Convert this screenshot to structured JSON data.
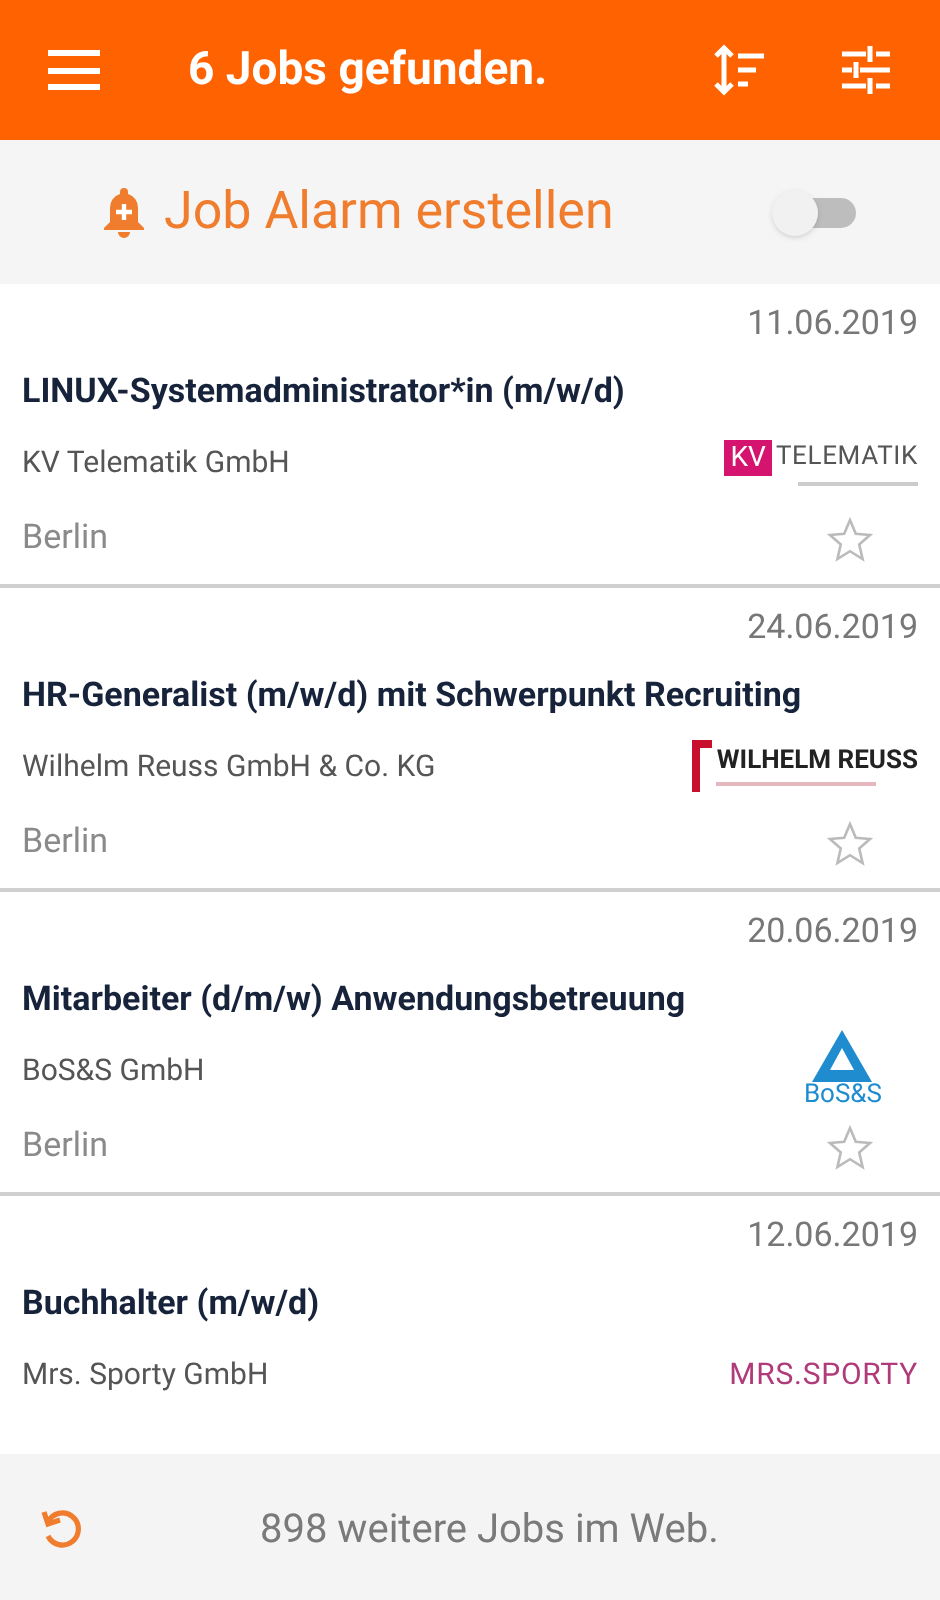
{
  "app_bar": {
    "title": "6 Jobs gefunden."
  },
  "job_alarm": {
    "label": "Job Alarm erstellen",
    "on": false
  },
  "jobs": [
    {
      "date": "11.06.2019",
      "title": "LINUX-Systemadministrator*in (m/w/d)",
      "company": "KV Telematik GmbH",
      "location": "Berlin",
      "starred": false,
      "logo": {
        "kind": "kv",
        "texts": [
          "KV",
          "TELEMATIK"
        ]
      }
    },
    {
      "date": "24.06.2019",
      "title": "HR-Generalist (m/w/d) mit Schwerpunkt Recruiting",
      "company": "Wilhelm Reuss GmbH & Co. KG",
      "location": "Berlin",
      "starred": false,
      "logo": {
        "kind": "reuss",
        "texts": [
          "WILHELM REUSS"
        ]
      }
    },
    {
      "date": "20.06.2019",
      "title": "Mitarbeiter (d/m/w) Anwendungsbetreuung",
      "company": "BoS&S GmbH",
      "location": "Berlin",
      "starred": false,
      "logo": {
        "kind": "boss",
        "texts": [
          "BoS&S"
        ]
      }
    },
    {
      "date": "12.06.2019",
      "title": "Buchhalter (m/w/d)",
      "company": "Mrs. Sporty GmbH",
      "logo": {
        "kind": "sporty",
        "texts": [
          "MRS.SPORTY"
        ]
      }
    }
  ],
  "footer": {
    "label": "898 weitere Jobs im Web."
  }
}
